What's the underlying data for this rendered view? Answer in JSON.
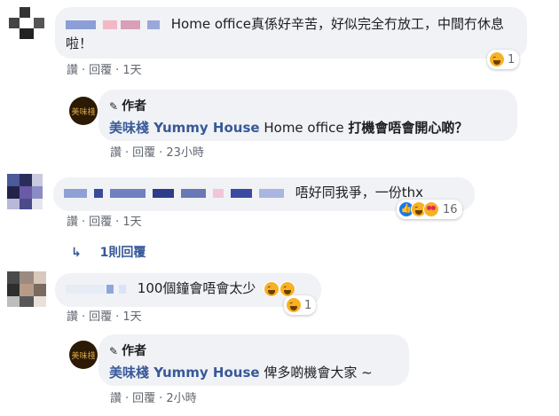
{
  "comments": [
    {
      "text": "Home office真係好辛苦，好似完全冇放工，中間冇休息啦！",
      "actions": {
        "like": "讚",
        "reply": "回覆",
        "time": "1天"
      },
      "reactions": {
        "count": "1"
      }
    },
    {
      "text": "唔好同我爭，一份thx",
      "actions": {
        "like": "讚",
        "reply": "回覆",
        "time": "1天"
      },
      "reactions": {
        "count": "16"
      },
      "replies_link": "1則回覆"
    },
    {
      "text": "100個鐘會唔會太少",
      "actions": {
        "like": "讚",
        "reply": "回覆",
        "time": "1天"
      },
      "reactions": {
        "count": "1"
      }
    }
  ],
  "replies": [
    {
      "author_tag": "作者",
      "author": "美味棧 Yummy House",
      "mention_prefix": "Home office ",
      "text": "打機會唔會開心啲？",
      "actions": {
        "like": "讚",
        "reply": "回覆",
        "time": "23小時"
      }
    },
    {
      "author_tag": "作者",
      "author": "美味棧 Yummy House",
      "text": "俾多啲機會大家 ~",
      "actions": {
        "like": "讚",
        "reply": "回覆",
        "time": "2小時"
      }
    }
  ],
  "logo_text": "美味棧",
  "colors": {
    "link": "#385898",
    "bubble": "#f0f2f5",
    "meta": "#606770",
    "haha": "#f7b125",
    "like": "#1877f2"
  }
}
